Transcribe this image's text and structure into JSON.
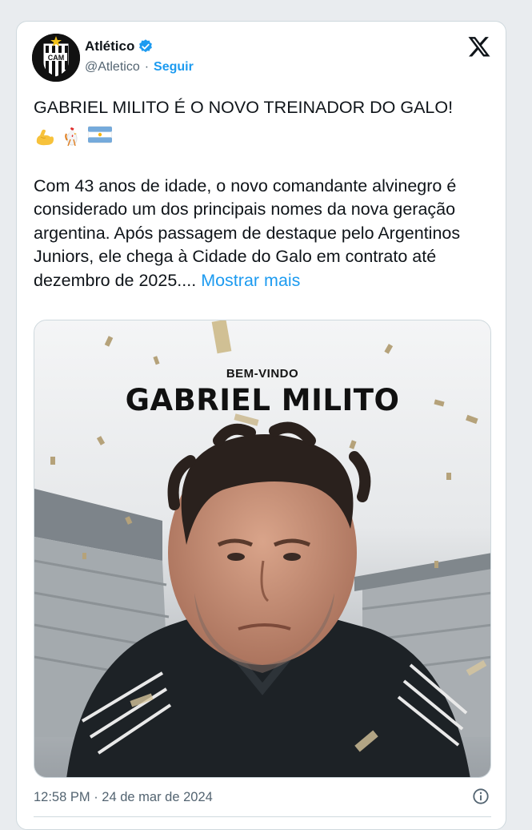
{
  "author": {
    "display_name": "Atlético",
    "handle": "@Atletico",
    "separator": "·",
    "follow_label": "Seguir",
    "avatar_text": "CAM",
    "verified": true
  },
  "post": {
    "headline": "GABRIEL MILITO É O NOVO TREINADOR DO GALO!",
    "emojis": [
      "flexed-biceps-emoji",
      "rooster-emoji",
      "argentina-flag-emoji"
    ],
    "body": "Com 43 anos de idade, o novo comandante alvinegro é considerado um dos principais nomes da nova geração argentina. Após passagem de destaque pelo Argentinos Juniors, ele chega à Cidade do Galo em contrato até dezembro de 2025....",
    "show_more_label": "Mostrar mais"
  },
  "media": {
    "welcome_text": "BEM-VINDO",
    "coach_name": "GABRIEL MILITO"
  },
  "footer": {
    "timestamp": "12:58 PM · 24 de mar de 2024"
  },
  "colors": {
    "link": "#1d9bf0",
    "verified": "#1d9bf0",
    "muted_text": "#536471",
    "border": "#cfd9de"
  },
  "icons": [
    "verified-badge-icon",
    "x-logo-icon",
    "info-icon"
  ]
}
